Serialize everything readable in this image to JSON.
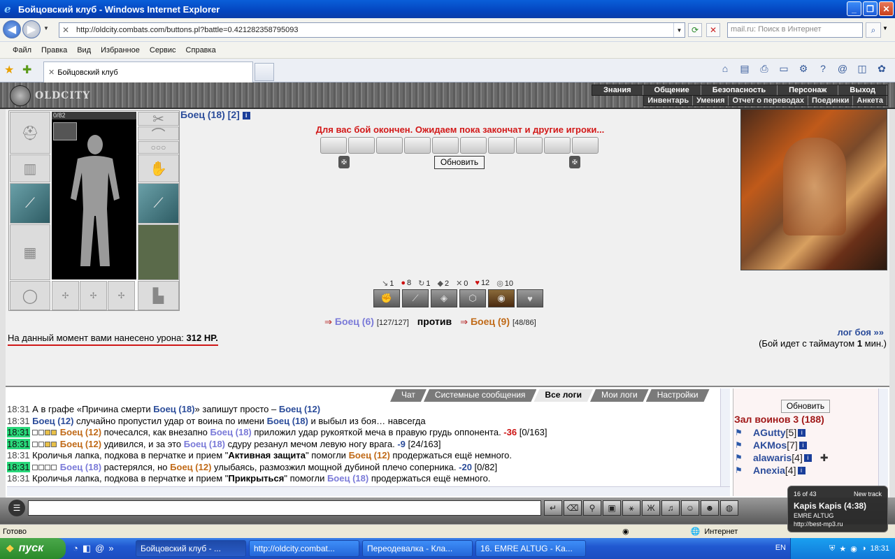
{
  "window": {
    "title": "Бойцовский клуб - Windows Internet Explorer"
  },
  "addressbar": {
    "url": "http://oldcity.combats.com/buttons.pl?battle=0.421282358795093",
    "search_placeholder": "mail.ru: Поиск в Интернет"
  },
  "menu": {
    "items": [
      "Файл",
      "Правка",
      "Вид",
      "Избранное",
      "Сервис",
      "Справка"
    ]
  },
  "tab": {
    "title": "Бойцовский клуб"
  },
  "site": {
    "logo": "OLDCITY",
    "top_menu": [
      "Знания",
      "Общение",
      "Безопасность",
      "Персонаж",
      "Выход"
    ],
    "sub_menu": [
      "Инвентарь",
      "Умения",
      "Отчет о переводах",
      "Поединки",
      "Анкета"
    ]
  },
  "inventory": {
    "hp": "0/82"
  },
  "battle": {
    "player": "Боец (18) [2]",
    "message": "Для вас бой окончен. Ожидаем пока закончат и другие игроки...",
    "refresh_label": "Обновить",
    "stats": [
      {
        "icon": "sword-icon",
        "glyph": "↘",
        "value": "1"
      },
      {
        "icon": "blood-icon",
        "glyph": "●",
        "value": "8"
      },
      {
        "icon": "counter-icon",
        "glyph": "↻",
        "value": "1"
      },
      {
        "icon": "shield-icon",
        "glyph": "◆",
        "value": "2"
      },
      {
        "icon": "cross-icon",
        "glyph": "✕",
        "value": "0"
      },
      {
        "icon": "heart-icon",
        "glyph": "♥",
        "value": "12"
      },
      {
        "icon": "guard-icon",
        "glyph": "◎",
        "value": "10"
      }
    ],
    "fighter1": "Боец (6)",
    "fighter1_hp": "[127/127]",
    "vs_label": "против",
    "fighter2": "Боец (9)",
    "fighter2_hp": "[48/86]",
    "damage_label": "На данный момент вами нанесено урона:",
    "damage_value": "312 HP.",
    "log_link": "лог боя »»",
    "timeout_prefix": "(Бой идет с таймаутом",
    "timeout_value": "1",
    "timeout_suffix": "мин.)"
  },
  "chat": {
    "tabs": [
      "Чат",
      "Системные сообщения",
      "Все логи",
      "Мои логи",
      "Настройки"
    ],
    "active_tab": "Все логи"
  },
  "log_lines": [
    {
      "time": "18:31",
      "hl": false,
      "parts": [
        [
          "",
          "А в графе «Причина смерти "
        ],
        [
          "n1",
          "Боец (18)"
        ],
        [
          "",
          "» запишут просто – "
        ],
        [
          "n1",
          "Боец (12)"
        ]
      ]
    },
    {
      "time": "18:31",
      "hl": false,
      "parts": [
        [
          "n1",
          "Боец (12)"
        ],
        [
          "",
          " случайно пропустил удар от воина по имени "
        ],
        [
          "n1",
          "Боец (18)"
        ],
        [
          "",
          " и выбыл из боя… навсегда"
        ]
      ]
    },
    {
      "time": "18:31",
      "hl": true,
      "sq": "y",
      "parts": [
        [
          "n2",
          "Боец (12)"
        ],
        [
          "",
          " почесался, как внезапно "
        ],
        [
          "n3",
          "Боец (18)"
        ],
        [
          "",
          " приложил удар рукояткой меча в правую грудь оппонента. "
        ],
        [
          "dmg",
          "-36"
        ],
        [
          "",
          " [0/163]"
        ]
      ]
    },
    {
      "time": "18:31",
      "hl": true,
      "sq": "y",
      "parts": [
        [
          "n2",
          "Боец (12)"
        ],
        [
          "",
          " удивился, и за это "
        ],
        [
          "n3",
          "Боец (18)"
        ],
        [
          "",
          " сдуру резанул мечом левую ногу врага. "
        ],
        [
          "dmg2",
          "-9"
        ],
        [
          "",
          " [24/163]"
        ]
      ]
    },
    {
      "time": "18:31",
      "hl": false,
      "parts": [
        [
          "",
          "Кроличья лапка, подкова в перчатке и прием \""
        ],
        [
          "b",
          "Активная защита"
        ],
        [
          "",
          "\" помогли "
        ],
        [
          "n2",
          "Боец (12)"
        ],
        [
          "",
          " продержаться ещё немного."
        ]
      ]
    },
    {
      "time": "18:31",
      "hl": true,
      "sq": "b",
      "parts": [
        [
          "n3",
          "Боец (18)"
        ],
        [
          "",
          " растерялся, но "
        ],
        [
          "n2",
          "Боец (12)"
        ],
        [
          "",
          " улыбаясь, размозжил мощной дубиной плечо соперника. "
        ],
        [
          "dmg2",
          "-20"
        ],
        [
          "",
          " [0/82]"
        ]
      ]
    },
    {
      "time": "18:31",
      "hl": false,
      "parts": [
        [
          "",
          "Кроличья лапка, подкова в перчатке и прием \""
        ],
        [
          "b",
          "Прикрыться"
        ],
        [
          "",
          "\" помогли "
        ],
        [
          "n3",
          "Боец (18)"
        ],
        [
          "",
          " продержаться ещё немного."
        ]
      ]
    }
  ],
  "room": {
    "refresh_label": "Обновить",
    "title": "Зал воинов 3 (188)",
    "players": [
      {
        "name": "AGutty",
        "level": "[5]"
      },
      {
        "name": "AKMos",
        "level": "[7]"
      },
      {
        "name": "alawaris",
        "level": "[4]"
      },
      {
        "name": "Anexia",
        "level": "[4]"
      }
    ]
  },
  "statusbar": {
    "text": "Готово",
    "zone": "Интернет"
  },
  "taskbar": {
    "start": "пуск",
    "tasks": [
      "Бойцовский клуб - ...",
      "http://oldcity.combat...",
      "Переодевалка - Кла...",
      "16. EMRE ALTUG - Ka..."
    ],
    "lang": "EN",
    "time": "18:31"
  },
  "notification": {
    "counter": "16 of 43",
    "label": "New track",
    "title": "Kapis Kapis (4:38)",
    "artist": "EMRE ALTUG",
    "url": "http://best-mp3.ru"
  }
}
